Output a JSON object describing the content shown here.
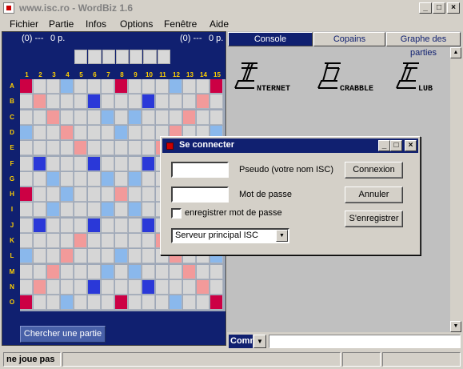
{
  "window": {
    "title": "www.isc.ro - WordBiz 1.6",
    "minimize_label": "_",
    "maximize_label": "□",
    "close_label": "×"
  },
  "menu": {
    "items": [
      "Fichier",
      "Partie",
      "Infos",
      "Options",
      "Fenêtre",
      "Aide"
    ]
  },
  "board_panel": {
    "score_left": "(0) ---",
    "points_left": "0 p.",
    "score_right": "(0) ---",
    "points_right": "0 p.",
    "columns": [
      "1",
      "2",
      "3",
      "4",
      "5",
      "6",
      "7",
      "8",
      "9",
      "10",
      "11",
      "12",
      "13",
      "14",
      "15"
    ],
    "rows": [
      "A",
      "B",
      "C",
      "D",
      "E",
      "F",
      "G",
      "H",
      "I",
      "J",
      "K",
      "L",
      "M",
      "N",
      "O"
    ],
    "find_button": "Chercher une partie"
  },
  "tabs": [
    {
      "label": "Console",
      "active": true
    },
    {
      "label": "Copains",
      "active": false
    },
    {
      "label": "Graphe des parties",
      "active": false
    }
  ],
  "console": {
    "logo_words": [
      "NTERNET",
      "CRABBLE",
      "LUB"
    ],
    "command_label": "Command",
    "command_value": ""
  },
  "status": {
    "state": "ne joue pas"
  },
  "dialog": {
    "title": "Se connecter",
    "pseudo_value": "",
    "pseudo_label": "Pseudo (votre nom ISC)",
    "password_value": "",
    "password_label": "Mot de passe",
    "remember_label": "enregistrer mot de passe",
    "remember_checked": false,
    "server_selected": "Serveur principal ISC",
    "connect_button": "Connexion",
    "cancel_button": "Annuler",
    "register_button": "S'enregistrer"
  },
  "colors": {
    "panel_blue": "#102070",
    "triple_word": "#cc0044",
    "double_word": "#f29a9a",
    "triple_letter": "#2a38d8",
    "double_letter": "#8ab8ec",
    "label_yellow": "#ffd000"
  }
}
